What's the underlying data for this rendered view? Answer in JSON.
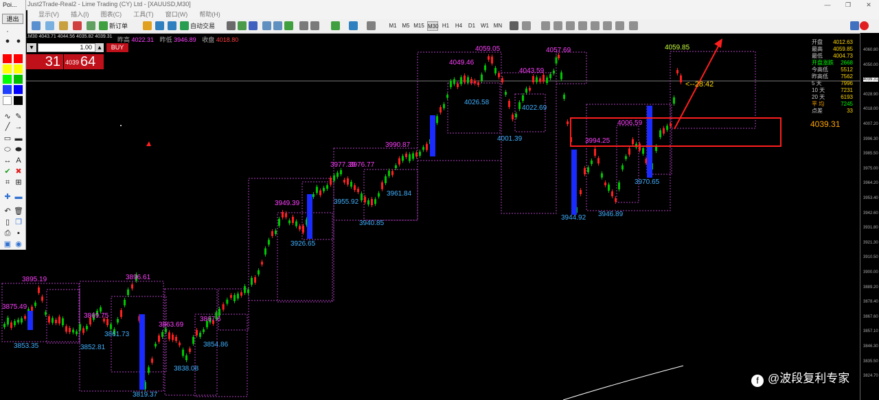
{
  "window": {
    "title": "Just2Trade-Real2 - Lime Trading (CY) Ltd - [XAUUSD,M30]",
    "panel_title": "Poi...",
    "minimize": "—",
    "restore": "❐",
    "close": "✕"
  },
  "menu": [
    "显示(V)",
    "插入(I)",
    "图表(C)",
    "工具(T)",
    "窗口(W)",
    "帮助(H)"
  ],
  "toolbar": {
    "new_order": "新订单",
    "auto_trade": "自动交易",
    "timeframes": [
      "M1",
      "M5",
      "M15",
      "M30",
      "H1",
      "H4",
      "D1",
      "W1",
      "MN"
    ],
    "active_timeframe": "M30"
  },
  "left_panel": {
    "exit": "退出",
    "colors": [
      "#ff0000",
      "#ffff00",
      "#00ff00",
      "#0000ff",
      "#000000",
      "#ffffff"
    ]
  },
  "chart_header": {
    "symbol_info": "..M30  4043.71 4044.56 4035.82 4039.31",
    "prev_high_label": "昨高",
    "prev_high": "4022.31",
    "prev_low_label": "昨低",
    "prev_low": "3946.89",
    "close_label": "收盘",
    "close": "4018.80"
  },
  "trade_panel": {
    "dec": "▾",
    "lots": "1.00",
    "inc": "▴",
    "buy_label": "BUY",
    "sell_big": "31",
    "buy_small": "4039",
    "buy_big": "64"
  },
  "stats": [
    {
      "k": "开盘",
      "v": "4012.63"
    },
    {
      "k": "最高",
      "v": "4059.85"
    },
    {
      "k": "最低",
      "v": "4004.73"
    },
    {
      "k": "开盘涨跌",
      "v": "2668"
    },
    {
      "k": "今高低",
      "v": "5512"
    },
    {
      "k": "昨高低",
      "v": "7562"
    },
    {
      "k": "5  天",
      "v": "7996"
    },
    {
      "k": "10 天",
      "v": "7231"
    },
    {
      "k": "20 天",
      "v": "6193"
    },
    {
      "k": "平  均",
      "v": "7245"
    },
    {
      "k": "点差",
      "v": "33"
    }
  ],
  "current_price": "4039.31",
  "countdown": "<--28:42",
  "watermark": "@波段复利专家",
  "price_axis": [
    "4060.80",
    "4050.00",
    "4039.31",
    "4028.90",
    "4018.00",
    "4007.20",
    "3996.30",
    "3985.50",
    "3975.00",
    "3964.20",
    "3953.40",
    "3942.60",
    "3931.80",
    "3921.30",
    "3910.50",
    "3900.00",
    "3889.20",
    "3878.40",
    "3867.60",
    "3857.10",
    "3846.30",
    "3835.50",
    "3824.70"
  ],
  "chart_data": {
    "type": "candlestick",
    "symbol": "XAUUSD",
    "timeframe": "M30",
    "price_labels": [
      {
        "text": "3895.19",
        "type": "high"
      },
      {
        "text": "3875.49",
        "type": "high"
      },
      {
        "text": "3853.35",
        "type": "low"
      },
      {
        "text": "3869.75",
        "type": "high"
      },
      {
        "text": "3852.81",
        "type": "low"
      },
      {
        "text": "3861.73",
        "type": "low"
      },
      {
        "text": "3896.61",
        "type": "high"
      },
      {
        "text": "3819.37",
        "type": "low"
      },
      {
        "text": "3863.69",
        "type": "high"
      },
      {
        "text": "3838.08",
        "type": "low"
      },
      {
        "text": "3867.6",
        "type": "high"
      },
      {
        "text": "3854.86",
        "type": "low"
      },
      {
        "text": "3949.39",
        "type": "high"
      },
      {
        "text": "3926.65",
        "type": "low"
      },
      {
        "text": "3977.39",
        "type": "high"
      },
      {
        "text": "3976.77",
        "type": "high"
      },
      {
        "text": "3955.92",
        "type": "low"
      },
      {
        "text": "3940.85",
        "type": "low"
      },
      {
        "text": "3990.87",
        "type": "high"
      },
      {
        "text": "3961.84",
        "type": "low"
      },
      {
        "text": "4049.46",
        "type": "high"
      },
      {
        "text": "4026.58",
        "type": "low"
      },
      {
        "text": "4059.05",
        "type": "high"
      },
      {
        "text": "4043.59",
        "type": "high"
      },
      {
        "text": "4022.69",
        "type": "low"
      },
      {
        "text": "4001.39",
        "type": "low"
      },
      {
        "text": "4057.69",
        "type": "high"
      },
      {
        "text": "3994.25",
        "type": "high"
      },
      {
        "text": "3944.92",
        "type": "low"
      },
      {
        "text": "4006.59",
        "type": "high"
      },
      {
        "text": "3946.89",
        "type": "low"
      },
      {
        "text": "3970.65",
        "type": "low"
      },
      {
        "text": "4059.85",
        "type": "high2"
      }
    ],
    "colors": {
      "up": "#00c800",
      "down": "#ff2020",
      "box": "#b040c0",
      "high_label": "#ff40ff",
      "low_label": "#40b0ff"
    }
  }
}
